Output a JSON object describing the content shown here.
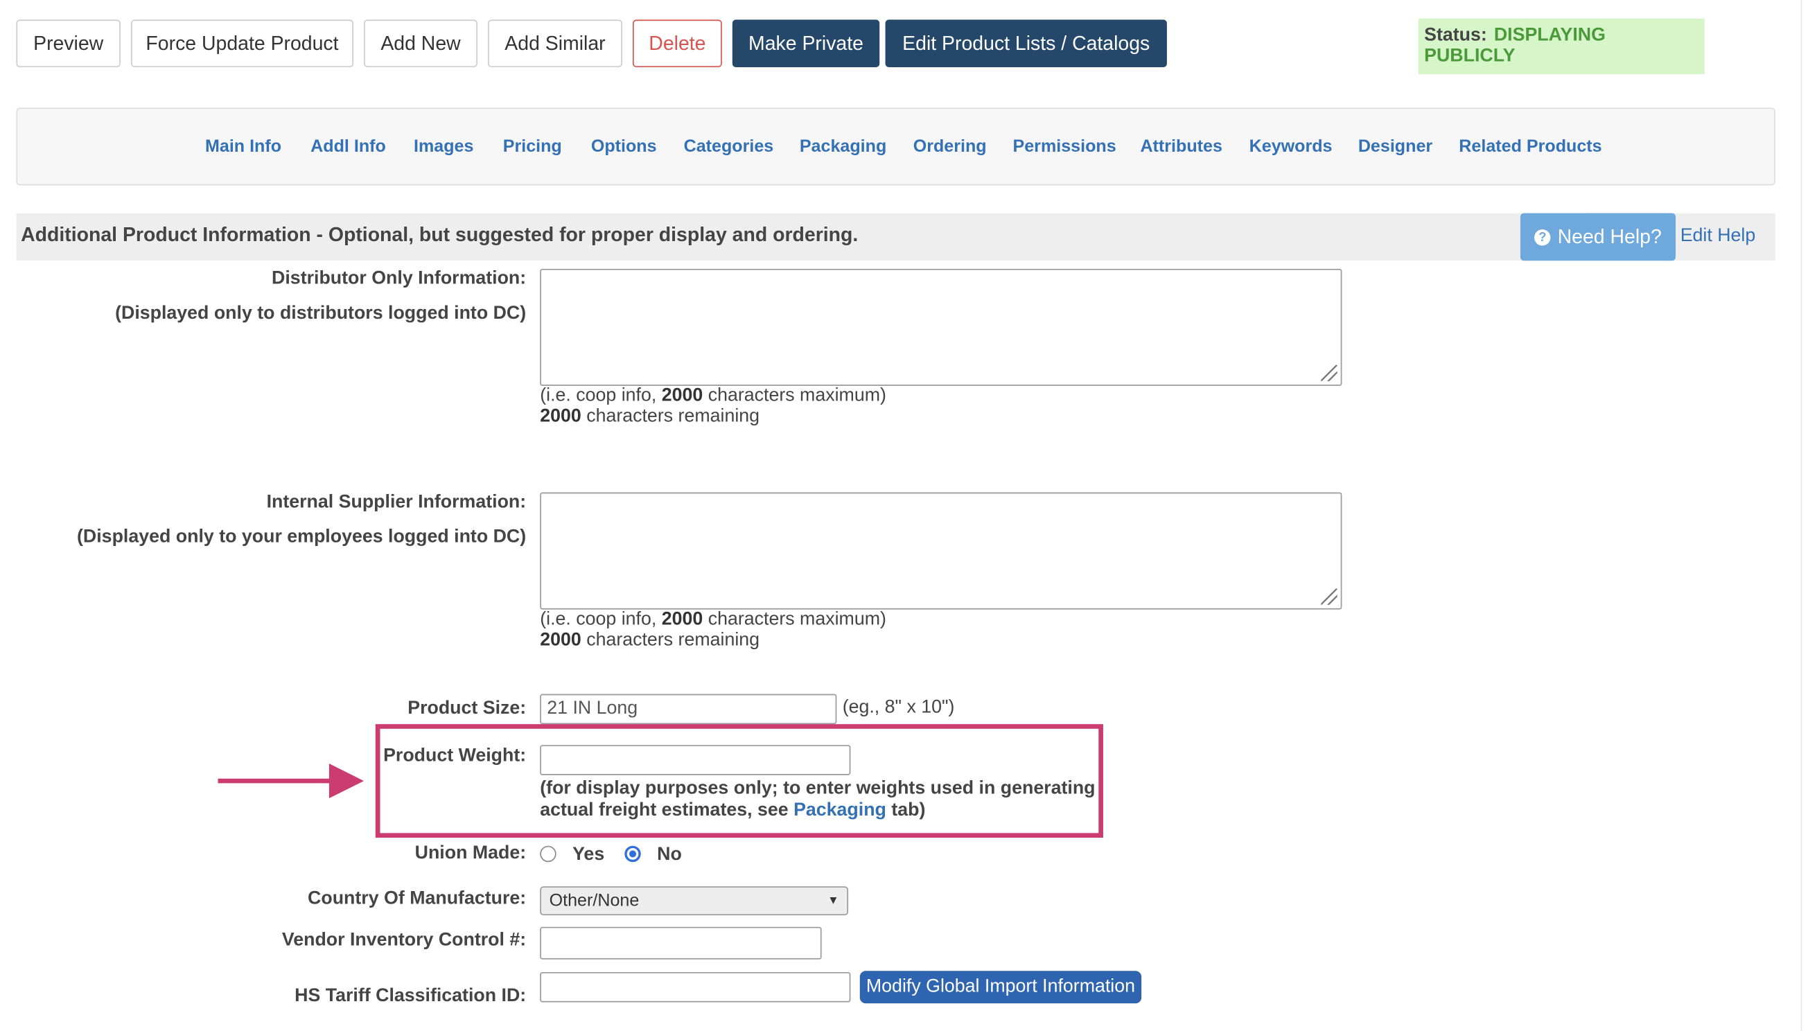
{
  "toolbar": {
    "preview": "Preview",
    "force_update": "Force Update Product",
    "add_new": "Add New",
    "add_similar": "Add Similar",
    "delete": "Delete",
    "make_private": "Make Private",
    "edit_lists": "Edit Product Lists / Catalogs"
  },
  "status": {
    "label": "Status:",
    "value": "DISPLAYING PUBLICLY",
    "color": "#4a9a3a"
  },
  "tabs": [
    "Main Info",
    "Addl Info",
    "Images",
    "Pricing",
    "Options",
    "Categories",
    "Packaging",
    "Ordering",
    "Permissions",
    "Attributes",
    "Keywords",
    "Designer",
    "Related Products"
  ],
  "section": {
    "title": "Additional Product Information - Optional, but suggested for proper display and ordering.",
    "need_help": "Need Help?",
    "edit_help": "Edit Help"
  },
  "distributor": {
    "label": "Distributor Only Information:",
    "sublabel": "(Displayed only to distributors logged into DC)",
    "value": "",
    "hint_prefix": "(i.e. coop info, ",
    "hint_max": "2000",
    "hint_suffix": " characters maximum)",
    "remaining_count": "2000",
    "remaining_text": " characters remaining"
  },
  "supplier": {
    "label": "Internal Supplier Information:",
    "sublabel": "(Displayed only to your employees logged into DC)",
    "value": "",
    "hint_prefix": "(i.e. coop info, ",
    "hint_max": "2000",
    "hint_suffix": " characters maximum)",
    "remaining_count": "2000",
    "remaining_text": " characters remaining"
  },
  "product_size": {
    "label": "Product Size:",
    "value": "21 IN Long",
    "example": "(eg., 8\" x 10\")"
  },
  "product_weight": {
    "label": "Product Weight:",
    "value": "",
    "note_line1": "(for display purposes only; to enter weights used in generating",
    "note_line2_prefix": "actual freight estimates, see ",
    "note_link": "Packaging",
    "note_line2_suffix": " tab)"
  },
  "union_made": {
    "label": "Union Made:",
    "yes": "Yes",
    "no": "No",
    "selected": "No"
  },
  "country": {
    "label": "Country Of Manufacture:",
    "selected": "Other/None"
  },
  "vendor_inventory": {
    "label": "Vendor Inventory Control #:",
    "value": ""
  },
  "hs_tariff": {
    "label": "HS Tariff Classification ID:",
    "value": "",
    "modify_button": "Modify Global Import Information"
  },
  "colors": {
    "navy": "#25476a",
    "link": "#3470b4",
    "highlight": "#cc3d6f",
    "status_bg": "#d6f5c9"
  }
}
